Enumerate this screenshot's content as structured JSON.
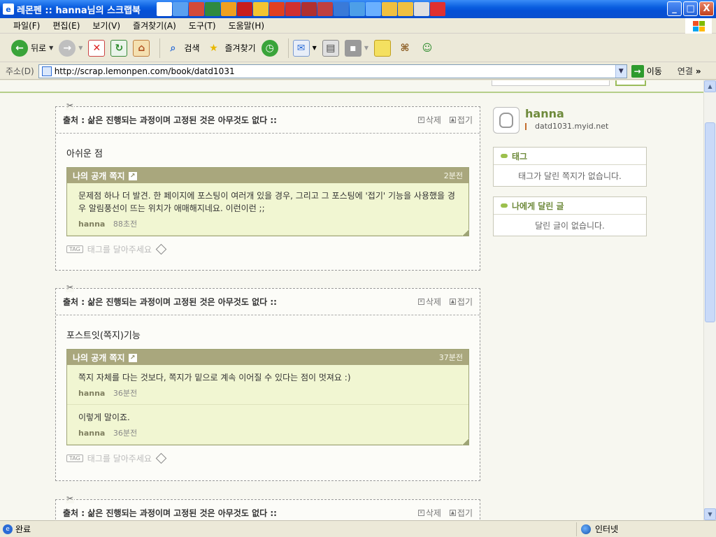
{
  "window": {
    "title": "레몬펜 :: hanna님의 스크랩북",
    "min": "_",
    "max": "□",
    "close": "X"
  },
  "menu": [
    "파일(F)",
    "편집(E)",
    "보기(V)",
    "즐겨찾기(A)",
    "도구(T)",
    "도움말(H)"
  ],
  "toolbar": {
    "back": "뒤로",
    "search": "검색",
    "favorites": "즐겨찾기"
  },
  "address": {
    "label": "주소(D)",
    "url": "http://scrap.lemonpen.com/book/datd1031",
    "go": "이동",
    "links": "연결"
  },
  "posts": [
    {
      "source": "출처 : 삶은 진행되는 과정이며 고정된 것은 아무것도 없다 ::",
      "delete": "삭제",
      "fold": "접기",
      "title": "아쉬운 점",
      "note": {
        "heading": "나의 공개 쪽지",
        "time": "2분전",
        "entries": [
          {
            "text": "문제점 하나 더 발견. 한 페이지에 포스팅이 여러개 있을 경우, 그리고 그 포스팅에 '접기' 기능을 사용했을 경우 알림풍선이 뜨는 위치가 애매해지네요. 이런이런 ;;",
            "author": "hanna",
            "time": "88초전"
          }
        ]
      },
      "tag_prompt": "태그를 달아주세요",
      "tag_badge": "TAG"
    },
    {
      "source": "출처 : 삶은 진행되는 과정이며 고정된 것은 아무것도 없다 ::",
      "delete": "삭제",
      "fold": "접기",
      "title": "포스트잇(쪽지)기능",
      "note": {
        "heading": "나의 공개 쪽지",
        "time": "37분전",
        "entries": [
          {
            "text": "쪽지 자체를 다는 것보다, 쪽지가 밑으로 계속 이어질 수 있다는 점이 멋져요 :)",
            "author": "hanna",
            "time": "36분전"
          },
          {
            "text": "이렇게 말이죠.",
            "author": "hanna",
            "time": "36분전"
          }
        ]
      },
      "tag_prompt": "태그를 달아주세요",
      "tag_badge": "TAG"
    },
    {
      "source": "출처 : 삶은 진행되는 과정이며 고정된 것은 아무것도 없다 ::",
      "delete": "삭제",
      "fold": "접기"
    }
  ],
  "sidebar": {
    "name": "hanna",
    "url": "datd1031.myid.net",
    "tag_heading": "태그",
    "tag_empty": "태그가 달린 쪽지가 없습니다.",
    "comments_heading": "나에게 달린 글",
    "comments_empty": "달린 글이 없습니다."
  },
  "status": {
    "left": "완료",
    "zone": "인터넷"
  },
  "colors": {
    "accent": "#6e8a3b",
    "note_header": "#a9a77d",
    "note_body": "#f1f6d2",
    "title_bar": "#0a5ee0"
  }
}
